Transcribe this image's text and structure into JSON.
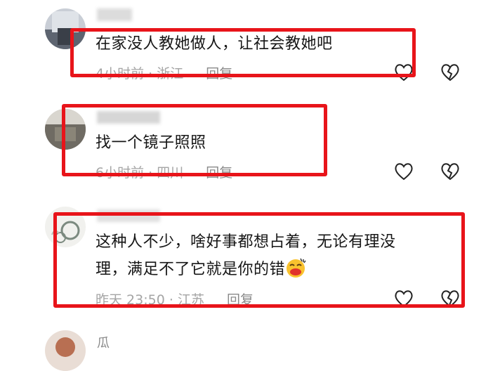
{
  "comments": [
    {
      "username": "",
      "text": "在家没人教她做人，让社会教她吧",
      "time": "4小时前",
      "location": "浙江",
      "reply_label": "回复"
    },
    {
      "username": "",
      "text": "找一个镜子照照",
      "time": "6小时前",
      "location": "四川",
      "reply_label": "回复"
    },
    {
      "username": "",
      "text_line1": "这种人不少，啥好事都想占着，无论有理没",
      "text_line2": "理，满足不了它就是你的错",
      "time": "昨天 23:50",
      "location": "江苏",
      "reply_label": "回复"
    },
    {
      "username": "瓜"
    }
  ],
  "icons": {
    "like": "heart-outline-icon",
    "dislike": "broken-heart-icon",
    "emoji": "face-with-hand-over-mouth-emoji"
  },
  "colors": {
    "highlight_box": "#e8141a",
    "text": "#161616",
    "meta": "#a5a5a5"
  }
}
